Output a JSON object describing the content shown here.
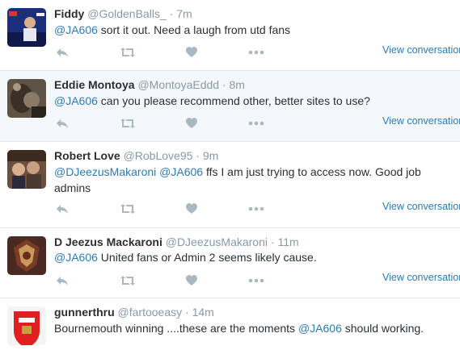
{
  "colors": {
    "link": "#2b7bb9",
    "meta": "#8899a6",
    "text": "#292f33",
    "icon": "#aab8c2",
    "divider": "#e1e8ed",
    "highlight_bg": "#f5f8fa"
  },
  "icons": {
    "reply": "reply-icon",
    "retweet": "retweet-icon",
    "like": "heart-icon",
    "more": "more-icon"
  },
  "tweets": [
    {
      "name": "Fiddy",
      "handle": "@GoldenBalls_",
      "separator": "·",
      "time": "7m",
      "segments": [
        {
          "type": "mention",
          "text": "@JA606"
        },
        {
          "type": "text",
          "text": " sort it out. Need a laugh from utd fans"
        }
      ],
      "view_conversation": "View conversation"
    },
    {
      "name": "Eddie Montoya",
      "handle": "@MontoyaEddd",
      "separator": "·",
      "time": "8m",
      "segments": [
        {
          "type": "mention",
          "text": "@JA606"
        },
        {
          "type": "text",
          "text": " can you please recommend other, better sites to use?"
        }
      ],
      "view_conversation": "View conversation"
    },
    {
      "name": "Robert Love",
      "handle": "@RobLove95",
      "separator": "·",
      "time": "9m",
      "segments": [
        {
          "type": "mention",
          "text": "@DJeezusMakaroni"
        },
        {
          "type": "text",
          "text": " "
        },
        {
          "type": "mention",
          "text": "@JA606"
        },
        {
          "type": "text",
          "text": " ffs I am just trying to access now. Good job admins"
        }
      ],
      "view_conversation": "View conversation"
    },
    {
      "name": "D Jeezus Mackaroni",
      "handle": "@DJeezusMakaroni",
      "separator": "·",
      "time": "11m",
      "segments": [
        {
          "type": "mention",
          "text": "@JA606"
        },
        {
          "type": "text",
          "text": " United fans or Admin 2 seems likely cause."
        }
      ],
      "view_conversation": "View conversation"
    },
    {
      "name": "gunnerthru",
      "handle": "@fartooeasy",
      "separator": "·",
      "time": "14m",
      "segments": [
        {
          "type": "text",
          "text": "Bournemouth winning ....these are the moments "
        },
        {
          "type": "mention",
          "text": "@JA606"
        },
        {
          "type": "text",
          "text": " should working."
        }
      ],
      "view_conversation": ""
    }
  ]
}
